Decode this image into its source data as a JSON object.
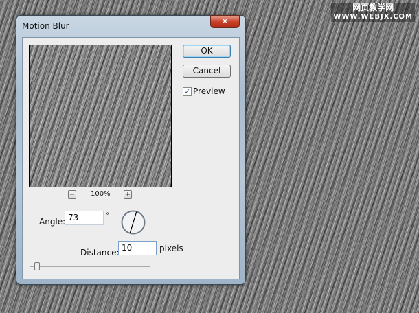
{
  "watermark": {
    "line1": "网页教学网",
    "line2": "WWW.WEBJX.COM"
  },
  "dialog": {
    "title": "Motion Blur",
    "close_label": "✕",
    "ok_label": "OK",
    "cancel_label": "Cancel",
    "preview_label": "Preview",
    "preview_checked": true,
    "check_glyph": "✓",
    "zoom_out": "−",
    "zoom_in": "+",
    "zoom_level": "100%",
    "angle_label": "Angle:",
    "angle_value": "73",
    "degree_symbol": "°",
    "distance_label": "Distance:",
    "distance_value": "10",
    "distance_unit": "pixels"
  }
}
